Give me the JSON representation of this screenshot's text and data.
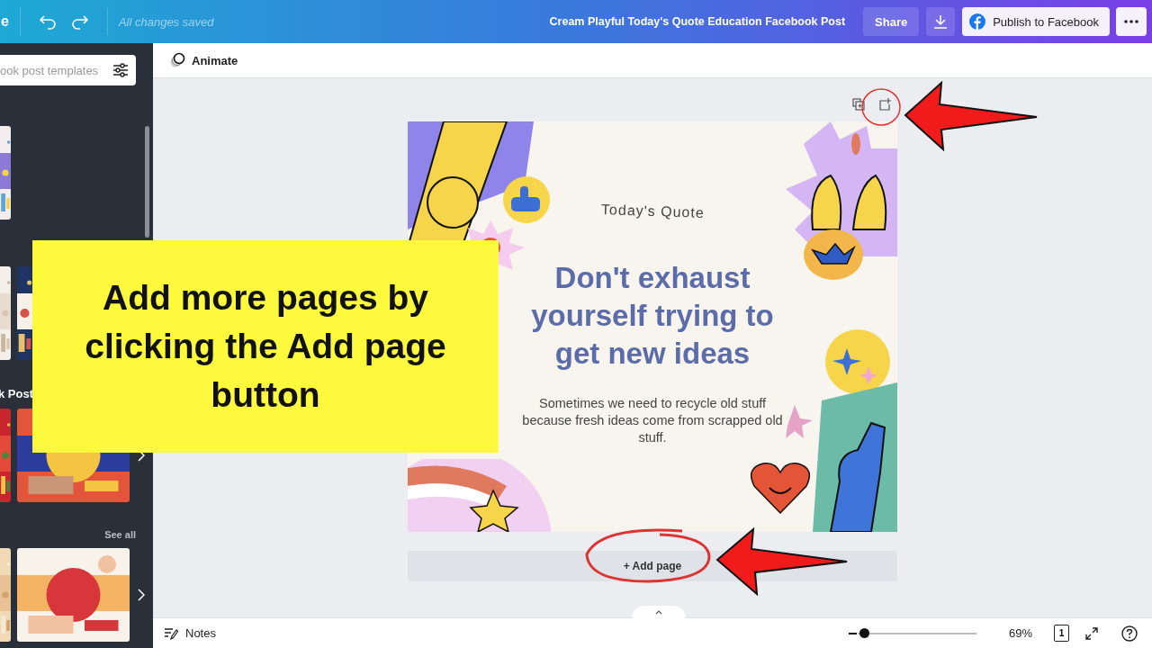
{
  "top_bar": {
    "menu_fragment": "e",
    "save_status": "All changes saved",
    "document_title": "Cream Playful Today's Quote Education Facebook Post",
    "share_button": "Share",
    "publish_button": "Publish to Facebook"
  },
  "sidebar": {
    "search_placeholder": "ook post templates",
    "section_heading": "k Post",
    "see_all": "See all"
  },
  "toolbar": {
    "animate_button": "Animate"
  },
  "design": {
    "subtitle": "Today's Quote",
    "headline": "Don't exhaust yourself trying to get new ideas",
    "body": "Sometimes we need to recycle old stuff because fresh ideas come from scrapped old stuff."
  },
  "add_page_button": "+ Add page",
  "bottom_bar": {
    "notes_button": "Notes",
    "zoom": {
      "level": 0.05,
      "reading": "69%"
    },
    "page_count": "1"
  },
  "callout": {
    "text": "Add more pages by clicking the Add page button"
  }
}
